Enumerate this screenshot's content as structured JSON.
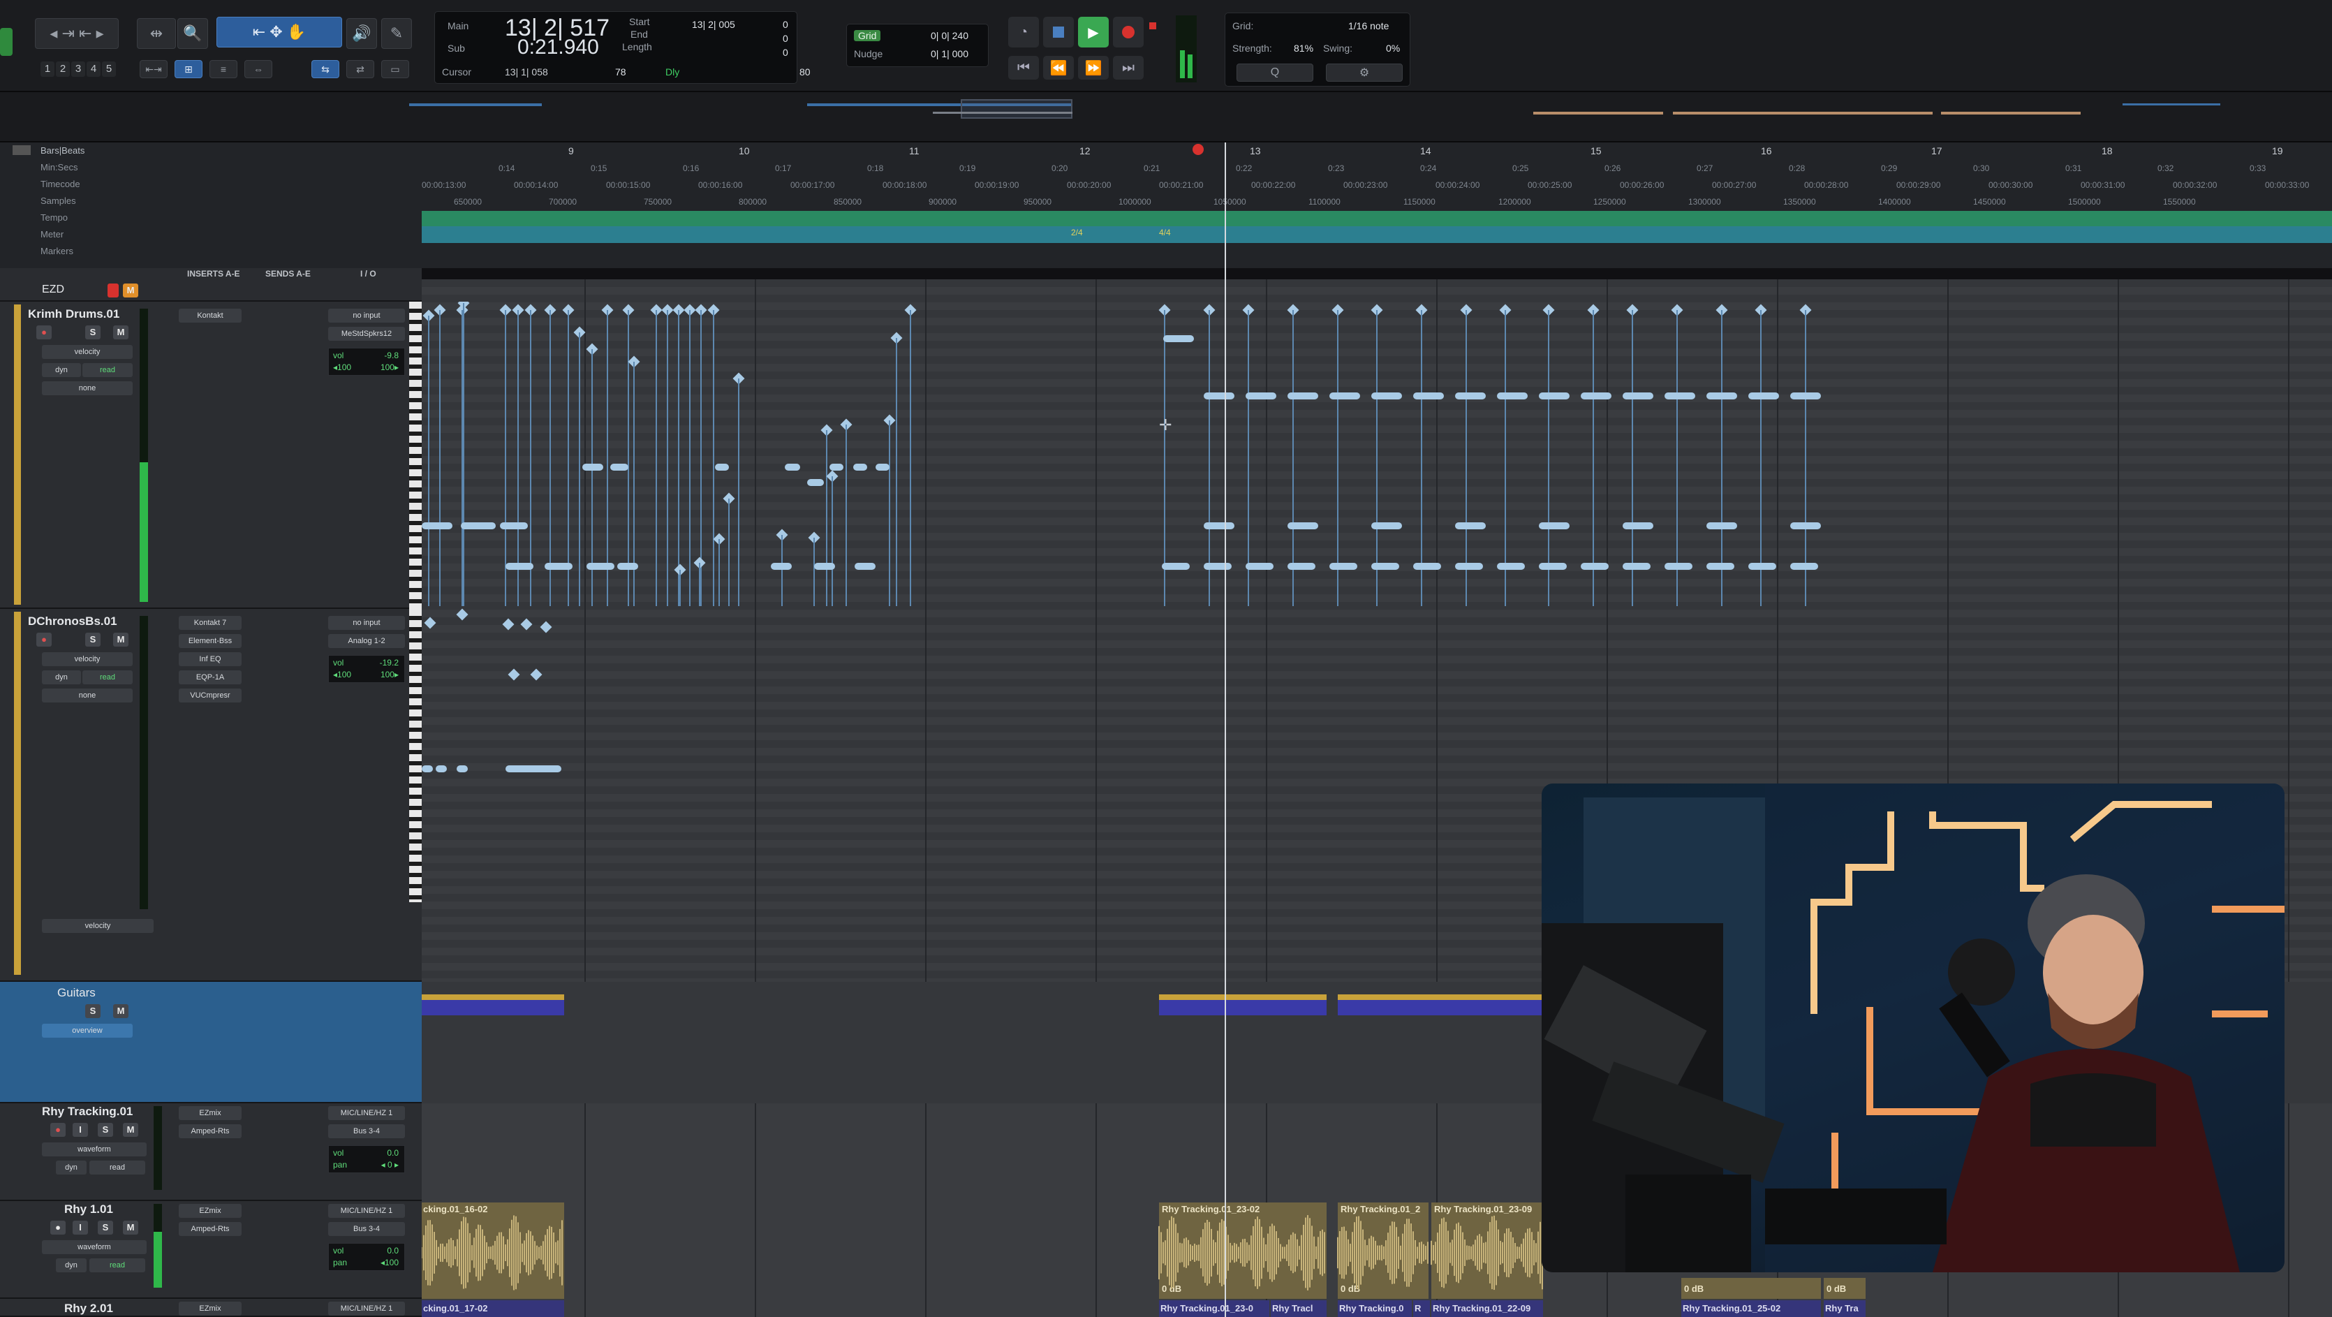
{
  "toolbar": {
    "num_keys": [
      "1",
      "2",
      "3",
      "4",
      "5"
    ],
    "counter": {
      "main_label": "Main",
      "sub_label": "Sub",
      "main_value": "13| 2| 517",
      "sub_value": "0:21.940",
      "cursor_label": "Cursor",
      "cursor_value": "13| 1| 058",
      "start_label": "Start",
      "end_label": "End",
      "length_label": "Length",
      "start_value": "13| 2| 005",
      "right_value_1": "0",
      "right_value_2": "0",
      "right_value_3": "0",
      "tempo_value": "78",
      "dly_label": "Dly",
      "last_value": "80"
    },
    "grid_nudge": {
      "grid_label": "Grid",
      "grid_value": "0| 0| 240",
      "nudge_label": "Nudge",
      "nudge_value": "0| 1| 000"
    },
    "quantize": {
      "grid_label": "Grid:",
      "grid_value": "1/16 note",
      "strength_label": "Strength:",
      "strength_value": "81%",
      "swing_label": "Swing:",
      "swing_value": "0%"
    }
  },
  "rulers": {
    "names": [
      "Bars|Beats",
      "Min:Secs",
      "Timecode",
      "Samples",
      "Tempo",
      "Meter",
      "Markers"
    ],
    "bars": [
      "9",
      "10",
      "11",
      "12",
      "13",
      "14",
      "15",
      "16",
      "17",
      "18",
      "19"
    ],
    "minsecs": [
      "0:14",
      "0:15",
      "0:16",
      "0:17",
      "0:18",
      "0:19",
      "0:20",
      "0:21",
      "0:22",
      "0:23",
      "0:24",
      "0:25",
      "0:26",
      "0:27",
      "0:28",
      "0:29",
      "0:30",
      "0:31",
      "0:32",
      "0:33"
    ],
    "timecode": [
      "00:00:13:00",
      "00:00:14:00",
      "00:00:15:00",
      "00:00:16:00",
      "00:00:17:00",
      "00:00:18:00",
      "00:00:19:00",
      "00:00:20:00",
      "00:00:21:00",
      "00:00:22:00",
      "00:00:23:00",
      "00:00:24:00",
      "00:00:25:00",
      "00:00:26:00",
      "00:00:27:00",
      "00:00:28:00",
      "00:00:29:00",
      "00:00:30:00",
      "00:00:31:00",
      "00:00:32:00",
      "00:00:33:00"
    ],
    "samples": [
      "650000",
      "700000",
      "750000",
      "800000",
      "850000",
      "900000",
      "950000",
      "1000000",
      "1050000",
      "1100000",
      "1150000",
      "1200000",
      "1250000",
      "1300000",
      "1350000",
      "1400000",
      "1450000",
      "1500000",
      "1550000"
    ],
    "meter_markers": [
      "2/4",
      "4/4"
    ]
  },
  "track_header": {
    "inserts": "INSERTS A-E",
    "sends": "SENDS A-E",
    "io": "I / O",
    "group": "EZD"
  },
  "tracks": {
    "krimh": {
      "name": "Krimh Drums.01",
      "insert": "Kontakt",
      "input": "no input",
      "output": "MeStdSpkrs12",
      "view": "velocity",
      "automation": "dyn",
      "automation_mode": "read",
      "group": "none",
      "vol_label": "vol",
      "vol": "-9.8",
      "pan_l": "◂100",
      "pan_r": "100▸"
    },
    "dchronos": {
      "name": "DChronosBs.01",
      "inserts": [
        "Kontakt 7",
        "Element-Bss",
        "Inf EQ",
        "EQP-1A",
        "VUCmpresr"
      ],
      "input": "no input",
      "output": "Analog 1-2",
      "view": "velocity",
      "automation": "dyn",
      "automation_mode": "read",
      "group": "none",
      "vol_label": "vol",
      "vol": "-19.2",
      "pan_l": "◂100",
      "pan_r": "100▸",
      "lane_label": "velocity"
    },
    "guitars": {
      "name": "Guitars",
      "view": "overview"
    },
    "rhy_tracking": {
      "name": "Rhy Tracking.01",
      "inserts": [
        "EZmix",
        "Amped-Rts"
      ],
      "input": "MIC/LINE/HZ 1",
      "output": "Bus 3-4",
      "view": "waveform",
      "automation": "dyn",
      "automation_mode": "read",
      "vol_label": "vol",
      "vol": "0.0",
      "pan_label": "pan",
      "pan": "◂ 0 ▸"
    },
    "rhy1": {
      "name": "Rhy 1.01",
      "inserts": [
        "EZmix",
        "Amped-Rts"
      ],
      "input": "MIC/LINE/HZ 1",
      "output": "Bus 3-4",
      "view": "waveform",
      "automation": "dyn",
      "automation_mode": "read",
      "vol_label": "vol",
      "vol": "0.0",
      "pan_label": "pan",
      "pan": "◂100"
    },
    "rhy2": {
      "name": "Rhy 2.01",
      "insert": "EZmix",
      "input": "MIC/LINE/HZ 1"
    }
  },
  "clips": {
    "rhy1_row": [
      "cking.01_16-02",
      "Rhy Tracking.01_23-02",
      "Rhy Tracking.01_2",
      "Rhy Tracking.01_23-09"
    ],
    "rhy2_row": [
      "cking.01_17-02",
      "Rhy Tracking.01_23-0",
      "Rhy Tracl",
      "Rhy Tracking.0",
      "R",
      "Rhy Tracking.01_22-09",
      "Rhy Tracking.01_25-02",
      "Rhy Tra"
    ],
    "gain_label": "0 dB"
  },
  "colors": {
    "selection_blue": "#2d5e9c",
    "midi_note": "#a9cbe6",
    "guitar_clip": "#c7b37a",
    "tempo_ruler": "#2a8a62",
    "meter_ruler": "#2c7f90",
    "playhead": "#d6dadf",
    "record_red": "#d8322e"
  }
}
